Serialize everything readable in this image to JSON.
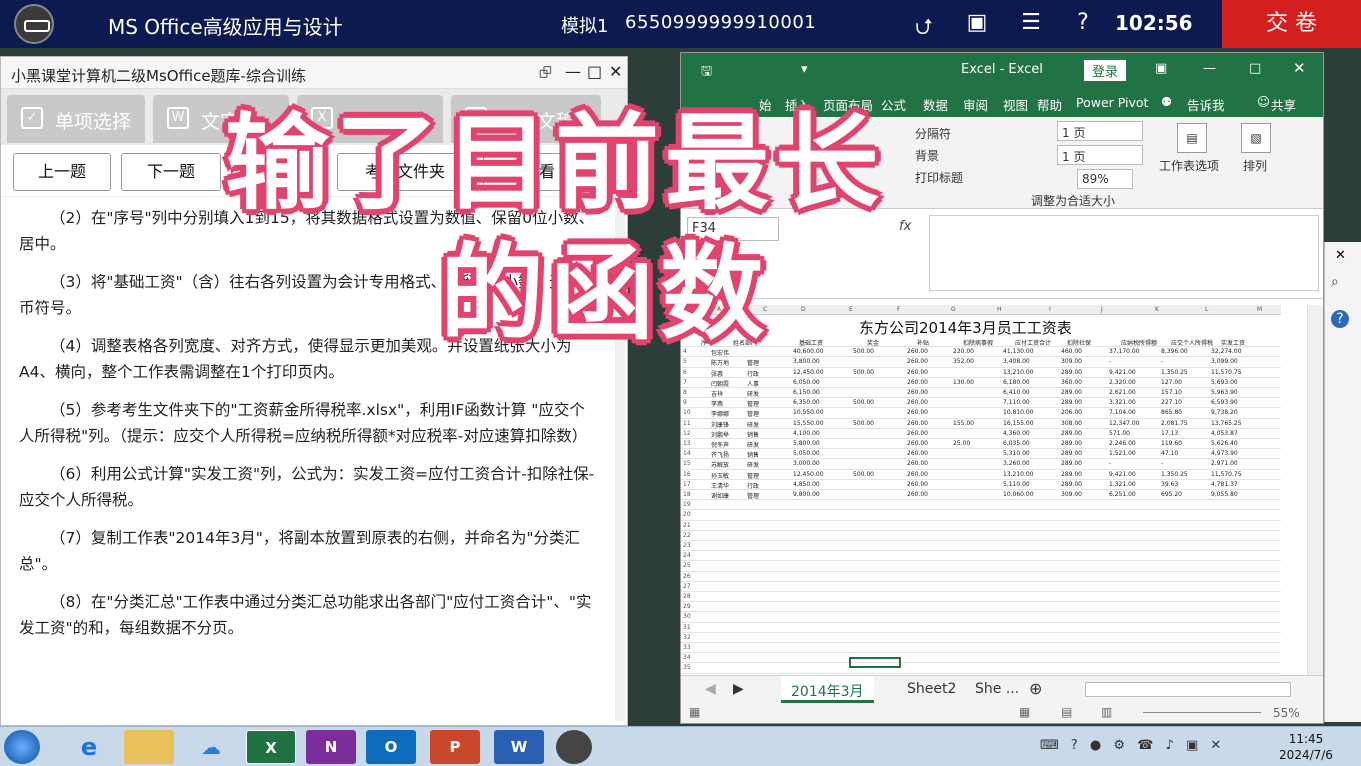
{
  "topbar": {
    "app_title": "MS Office高级应用与设计",
    "mock_label": "模拟1",
    "ticket_no": "6550999999910001",
    "timer": "102:56",
    "submit_label": "交 卷",
    "icons": [
      "collapse-icon",
      "window-icon",
      "list-icon",
      "help-icon"
    ]
  },
  "question_panel": {
    "window_title": "小黑课堂计算机二级MsOffice题库-综合训练",
    "tabs": [
      {
        "label": "单项选择",
        "icon": "checkbox-icon"
      },
      {
        "label": "文字",
        "icon": "word-icon"
      },
      {
        "label": "电子表格",
        "icon": "excel-icon"
      },
      {
        "label": "演示文稿",
        "icon": "ppt-icon"
      }
    ],
    "buttons": {
      "prev": "上一题",
      "next": "下一题",
      "answer": "答案",
      "open_folder": "考生文件夹",
      "view": "查看"
    },
    "questions": [
      "（2）在\"序号\"列中分别填入1到15，将其数据格式设置为数值、保留0位小数、居中。",
      "（3）将\"基础工资\"（含）往右各列设置为会计专用格式、保留2位小数、无货币符号。",
      "（4）调整表格各列宽度、对齐方式，使得显示更加美观。并设置纸张大小为A4、横向，整个工作表需调整在1个打印页内。",
      "（5）参考考生文件夹下的\"工资薪金所得税率.xlsx\"，利用IF函数计算 \"应交个人所得税\"列。（提示：应交个人所得税=应纳税所得额*对应税率-对应速算扣除数）",
      "（6）利用公式计算\"实发工资\"列，公式为：实发工资=应付工资合计-扣除社保-应交个人所得税。",
      "（7）复制工作表\"2014年3月\"，将副本放置到原表的右侧，并命名为\"分类汇总\"。",
      "（8）在\"分类汇总\"工作表中通过分类汇总功能求出各部门\"应付工资合计\"、\"实发工资\"的和，每组数据不分页。"
    ]
  },
  "excel": {
    "window_title": "Excel - Excel",
    "login_label": "登录",
    "ribbon_tabs": [
      "始",
      "插入",
      "页面布局",
      "公式",
      "数据",
      "审阅",
      "视图",
      "帮助",
      "Power Pivot",
      "告诉我",
      "共享"
    ],
    "ribbon": {
      "page_break": "分隔符",
      "background": "背景",
      "print_titles": "打印标题",
      "width_value": "1 页",
      "height_value": "1 页",
      "scale_value": "89%",
      "group_label": "调整为合适大小",
      "sheet_options": "工作表选项",
      "arrange": "排列"
    },
    "name_box": "F34",
    "fx_label": "fx",
    "sheet_title": "东方公司2014年3月员工工资表",
    "columns": [
      "A",
      "B",
      "C",
      "D",
      "E",
      "F",
      "G",
      "H",
      "I",
      "J",
      "K",
      "L",
      "M"
    ],
    "header_row": [
      "序号",
      "姓名",
      "部门",
      "基础工资",
      "奖金",
      "补贴",
      "扣除病事假",
      "应付工资合计",
      "扣除社保",
      "应纳税所得额",
      "应交个人所得税",
      "实发工资"
    ],
    "rows": [
      {
        "n": "4",
        "name": "包宏伟",
        "dept": "",
        "base": "40,600.00",
        "bonus": "500.00",
        "allow": "260.00",
        "sick": "230.00",
        "total": "41,130.00",
        "social": "460.00",
        "taxable": "37,170.00",
        "tax": "8,396.00",
        "net": "32,274.00"
      },
      {
        "n": "5",
        "name": "陈万地",
        "dept": "管理",
        "base": "3,800.00",
        "bonus": "",
        "allow": "260.00",
        "sick": "352.00",
        "total": "3,408.00",
        "social": "309.00",
        "taxable": "-",
        "tax": "-",
        "net": "3,099.00"
      },
      {
        "n": "6",
        "name": "张惠",
        "dept": "行政",
        "base": "12,450.00",
        "bonus": "500.00",
        "allow": "260.00",
        "sick": "",
        "total": "13,210.00",
        "social": "289.00",
        "taxable": "9,421.00",
        "tax": "1,350.25",
        "net": "11,570.75"
      },
      {
        "n": "7",
        "name": "闫朝霞",
        "dept": "人事",
        "base": "6,050.00",
        "bonus": "",
        "allow": "260.00",
        "sick": "130.00",
        "total": "6,180.00",
        "social": "360.00",
        "taxable": "2,320.00",
        "tax": "127.00",
        "net": "5,693.00"
      },
      {
        "n": "8",
        "name": "吉祥",
        "dept": "研发",
        "base": "6,150.00",
        "bonus": "",
        "allow": "260.00",
        "sick": "",
        "total": "6,410.00",
        "social": "289.00",
        "taxable": "2,621.00",
        "tax": "157.10",
        "net": "5,963.90"
      },
      {
        "n": "9",
        "name": "李燕",
        "dept": "管理",
        "base": "6,350.00",
        "bonus": "500.00",
        "allow": "260.00",
        "sick": "",
        "total": "7,110.00",
        "social": "289.00",
        "taxable": "3,321.00",
        "tax": "227.10",
        "net": "6,593.90"
      },
      {
        "n": "10",
        "name": "李娜娜",
        "dept": "管理",
        "base": "10,550.00",
        "bonus": "",
        "allow": "260.00",
        "sick": "",
        "total": "10,810.00",
        "social": "206.00",
        "taxable": "7,104.00",
        "tax": "865.80",
        "net": "9,738.20"
      },
      {
        "n": "11",
        "name": "刘康锋",
        "dept": "研发",
        "base": "15,550.00",
        "bonus": "500.00",
        "allow": "260.00",
        "sick": "155.00",
        "total": "16,155.00",
        "social": "308.00",
        "taxable": "12,347.00",
        "tax": "2,081.75",
        "net": "13,765.25"
      },
      {
        "n": "12",
        "name": "刘鹏举",
        "dept": "销售",
        "base": "4,100.00",
        "bonus": "",
        "allow": "260.00",
        "sick": "",
        "total": "4,360.00",
        "social": "289.00",
        "taxable": "571.00",
        "tax": "17.13",
        "net": "4,053.87"
      },
      {
        "n": "13",
        "name": "倪冬声",
        "dept": "研发",
        "base": "5,800.00",
        "bonus": "",
        "allow": "260.00",
        "sick": "25.00",
        "total": "6,035.00",
        "social": "289.00",
        "taxable": "2,246.00",
        "tax": "119.60",
        "net": "5,626.40"
      },
      {
        "n": "14",
        "name": "齐飞扬",
        "dept": "销售",
        "base": "5,050.00",
        "bonus": "",
        "allow": "260.00",
        "sick": "",
        "total": "5,310.00",
        "social": "289.00",
        "taxable": "1,521.00",
        "tax": "47.10",
        "net": "4,973.90"
      },
      {
        "n": "15",
        "name": "苏解放",
        "dept": "研发",
        "base": "3,000.00",
        "bonus": "",
        "allow": "260.00",
        "sick": "",
        "total": "3,260.00",
        "social": "289.00",
        "taxable": "-",
        "tax": "-",
        "net": "2,971.00"
      },
      {
        "n": "16",
        "name": "孙玉敏",
        "dept": "管理",
        "base": "12,450.00",
        "bonus": "500.00",
        "allow": "260.00",
        "sick": "",
        "total": "13,210.00",
        "social": "289.00",
        "taxable": "9,421.00",
        "tax": "1,350.25",
        "net": "11,570.75"
      },
      {
        "n": "17",
        "name": "王清华",
        "dept": "行政",
        "base": "4,850.00",
        "bonus": "",
        "allow": "260.00",
        "sick": "",
        "total": "5,110.00",
        "social": "289.00",
        "taxable": "1,321.00",
        "tax": "39.63",
        "net": "4,781.37"
      },
      {
        "n": "18",
        "name": "谢如康",
        "dept": "管理",
        "base": "9,800.00",
        "bonus": "",
        "allow": "260.00",
        "sick": "",
        "total": "10,060.00",
        "social": "309.00",
        "taxable": "6,251.00",
        "tax": "695.20",
        "net": "9,055.80"
      }
    ],
    "empty_rows": [
      "19",
      "20",
      "21",
      "22",
      "23",
      "24",
      "25",
      "26",
      "27",
      "28",
      "29",
      "30",
      "31",
      "32",
      "33",
      "34",
      "35"
    ],
    "sheet_tabs": [
      "2014年3月",
      "Sheet2",
      "She ..."
    ],
    "zoom": "55%"
  },
  "overlay": {
    "line1": "输了目前最长",
    "line2": "的函数"
  },
  "taskbar": {
    "apps": [
      "start-icon",
      "ie-icon",
      "explorer-icon",
      "cloud-icon",
      "excel-icon",
      "onenote-icon",
      "outlook-icon",
      "powerpoint-icon",
      "word-icon",
      "avatar-icon"
    ],
    "app_letters": {
      "excel": "X",
      "onenote": "N",
      "outlook": "O",
      "powerpoint": "P",
      "word": "W"
    },
    "time": "11:45",
    "date": "2024/7/6"
  }
}
